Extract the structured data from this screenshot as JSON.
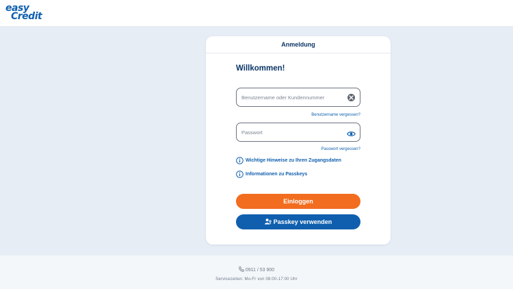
{
  "brand": {
    "line1": "easy",
    "line2": "Credit"
  },
  "card": {
    "title": "Anmeldung",
    "welcome": "Willkommen!",
    "username_placeholder": "Benutzername oder Kundennummer",
    "forgot_username": "Benutzername vergessen?",
    "password_placeholder": "Passwort",
    "forgot_password": "Passwort vergessen?",
    "info_links": [
      {
        "label": "Wichtige Hinweise zu Ihren Zugangsdaten",
        "icon": "info-icon"
      },
      {
        "label": "Informationen zu Passkeys",
        "icon": "info-icon"
      }
    ],
    "login_button": "Einloggen",
    "passkey_button": "Passkey verwenden"
  },
  "footer": {
    "phone": "0911 / 53 900",
    "service_hours": "Servicezeiten: Mo-Fr von 08:00-17:00 Uhr"
  },
  "colors": {
    "brand_blue": "#0f5fae",
    "navy_text": "#0a3566",
    "login_orange": "#f26d1f",
    "page_background": "#e6edf5"
  },
  "icons": [
    "clear-icon",
    "eye-icon",
    "info-icon",
    "passkey-user-icon",
    "phone-icon"
  ]
}
